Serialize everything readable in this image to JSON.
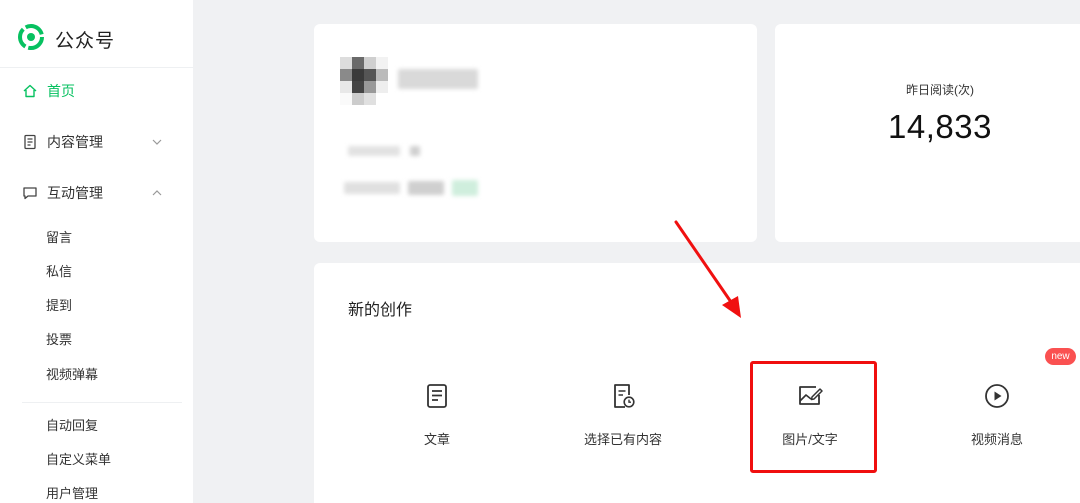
{
  "app": {
    "title": "公众号"
  },
  "sidebar": {
    "home": {
      "label": "首页",
      "active": true
    },
    "content_mgmt": {
      "label": "内容管理",
      "expanded": false
    },
    "interaction_mgmt": {
      "label": "互动管理",
      "expanded": true,
      "items": [
        "留言",
        "私信",
        "提到",
        "投票",
        "视频弹幕"
      ]
    },
    "more_items": [
      "自动回复",
      "自定义菜单",
      "用户管理"
    ]
  },
  "stats": {
    "label": "昨日阅读(次)",
    "value": "14,833"
  },
  "create": {
    "title": "新的创作",
    "items": [
      {
        "label": "文章",
        "icon": "article-icon"
      },
      {
        "label": "选择已有内容",
        "icon": "existing-content-icon"
      },
      {
        "label": "图片/文字",
        "icon": "image-text-icon"
      },
      {
        "label": "视频消息",
        "icon": "video-message-icon"
      }
    ],
    "new_badge": "new"
  },
  "colors": {
    "accent": "#07c160",
    "highlight": "#f00f0f",
    "badge": "#fa5151"
  }
}
